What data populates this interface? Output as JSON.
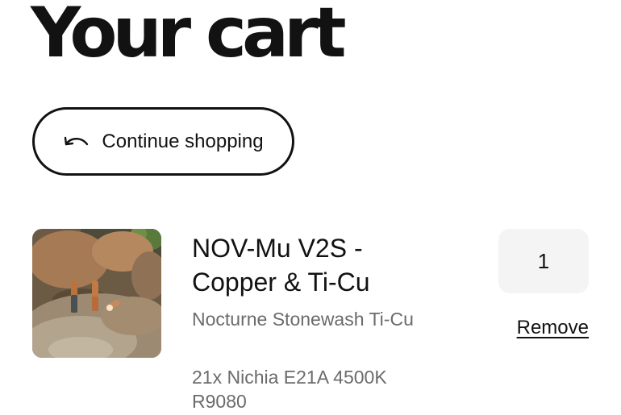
{
  "page": {
    "title": "Your cart"
  },
  "continue_button": {
    "label": "Continue shopping",
    "icon": "undo-arrow-icon"
  },
  "cart": {
    "items": [
      {
        "name": "NOV-Mu V2S - Copper & Ti-Cu",
        "variant": "Nocturne Stonewash Ti-Cu",
        "spec": "21x Nichia E21A 4500K R9080",
        "quantity": "1",
        "remove_label": "Remove",
        "image_icon": "product-photo-flashlights-on-rocks"
      }
    ]
  }
}
